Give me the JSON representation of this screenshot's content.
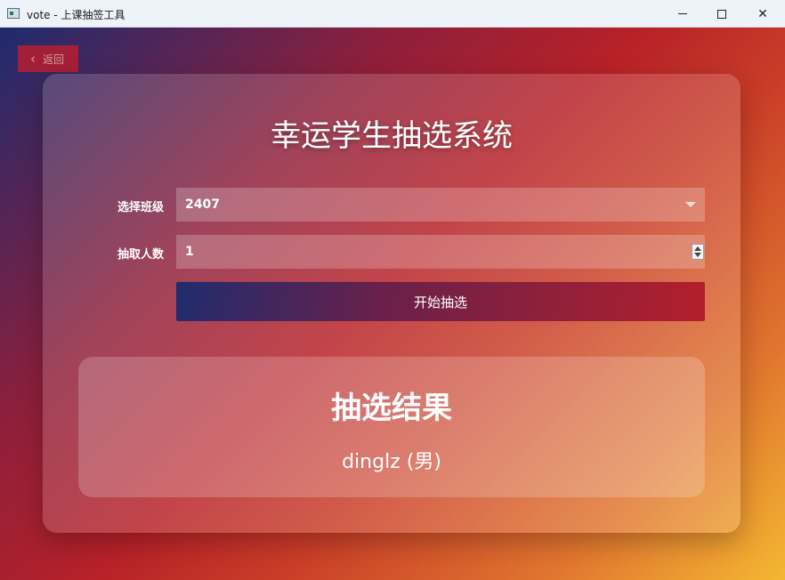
{
  "window": {
    "title": "vote - 上课抽签工具",
    "icon": "app-window-icon",
    "controls": {
      "minimize": "minimize-icon",
      "maximize": "maximize-icon",
      "close": "✕"
    }
  },
  "back_button": {
    "icon": "chevron-left-icon",
    "chevron": "‹",
    "label": "返回"
  },
  "main": {
    "title": "幸运学生抽选系统",
    "class_select": {
      "label": "选择班级",
      "value": "2407"
    },
    "count_input": {
      "label": "抽取人数",
      "value": "1"
    },
    "start_button": {
      "label": "开始抽选"
    }
  },
  "result": {
    "title": "抽选结果",
    "value": "dinglz (男)"
  },
  "colors": {
    "gradient": [
      "#1e2b6e",
      "#8e1f3b",
      "#b72128",
      "#c93d28",
      "#e0752f",
      "#f4b731"
    ],
    "button_gradient": [
      "#1f2c6e",
      "#6b2049",
      "#b31f2c"
    ],
    "text": "#ffffff"
  }
}
